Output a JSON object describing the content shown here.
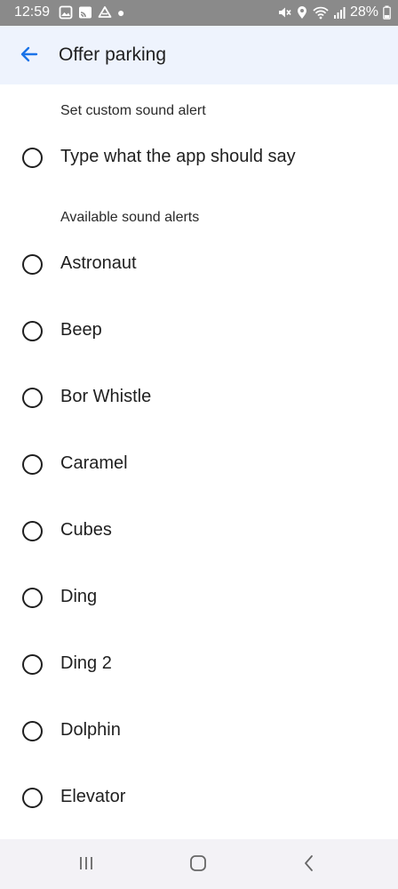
{
  "status_bar": {
    "time": "12:59",
    "battery": "28%",
    "left_icons": [
      "gallery-icon",
      "cast-icon",
      "drive-icon",
      "notification-dot-icon"
    ],
    "right_icons": [
      "mute-icon",
      "location-icon",
      "wifi-icon",
      "signal-icon",
      "battery-icon"
    ]
  },
  "header": {
    "back_icon": "arrow-left-icon",
    "title": "Offer parking",
    "accent_color": "#1a73e8"
  },
  "custom_section": {
    "label": "Set custom sound alert",
    "option": "Type what the app should say"
  },
  "available_section": {
    "label": "Available sound alerts",
    "options": [
      "Astronaut",
      "Beep",
      "Bor Whistle",
      "Caramel",
      "Cubes",
      "Ding",
      "Ding 2",
      "Dolphin",
      "Elevator"
    ]
  },
  "nav_bar": {
    "buttons": [
      "recent-apps-icon",
      "home-icon",
      "back-icon"
    ]
  }
}
